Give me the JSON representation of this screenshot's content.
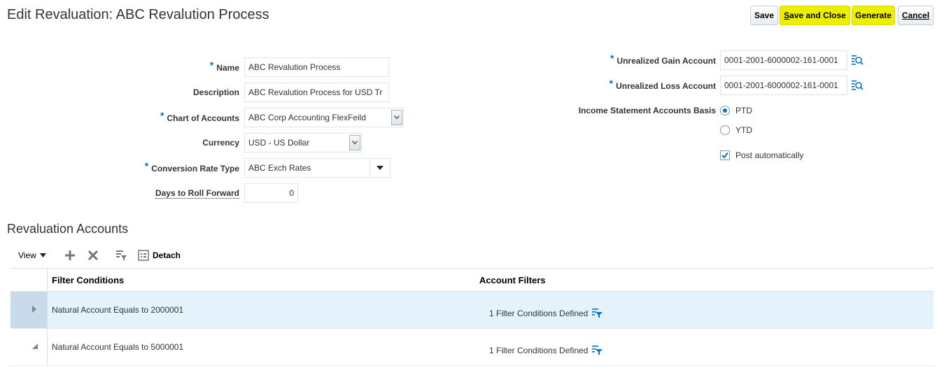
{
  "page": {
    "title": "Edit Revaluation: ABC Revalution Process"
  },
  "toolbar": {
    "save_label": "Save",
    "save_close_prefix": "S",
    "save_close_rest": "ave and Close",
    "generate_label": "Generate",
    "cancel_prefix": "C",
    "cancel_rest": "ancel",
    "highlight_color": "#ecf000"
  },
  "form": {
    "name": {
      "label": "Name",
      "required": true,
      "value": "ABC Revalution Process"
    },
    "description": {
      "label": "Description",
      "value": "ABC Revalution Process for USD Tr"
    },
    "chart_of_accounts": {
      "label": "Chart of Accounts",
      "required": true,
      "value": "ABC Corp Accounting FlexFeild"
    },
    "currency": {
      "label": "Currency",
      "value": "USD - US Dollar"
    },
    "conversion_rate_type": {
      "label": "Conversion Rate Type",
      "required": true,
      "value": "ABC Exch Rates"
    },
    "days_to_roll_forward": {
      "label": "Days to Roll Forward",
      "value": "0"
    },
    "unrealized_gain_account": {
      "label": "Unrealized Gain Account",
      "required": true,
      "value": "0001-2001-6000002-161-0001"
    },
    "unrealized_loss_account": {
      "label": "Unrealized Loss Account",
      "required": true,
      "value": "0001-2001-6000002-161-0001"
    },
    "income_statement_basis": {
      "label": "Income Statement Accounts Basis",
      "options": [
        "PTD",
        "YTD"
      ],
      "selected": "PTD"
    },
    "post_automatically": {
      "label": "Post automatically",
      "checked": true
    },
    "required_marker": "*"
  },
  "section": {
    "title": "Revaluation Accounts"
  },
  "table_toolbar": {
    "view_label": "View",
    "detach_label": "Detach"
  },
  "table": {
    "columns": [
      "Filter Conditions",
      "Account Filters"
    ],
    "rows": [
      {
        "filter_condition": "Natural Account Equals to 2000001",
        "account_filters": "1 Filter Conditions Defined",
        "expanded": false,
        "selected": true
      },
      {
        "filter_condition": "Natural Account Equals to 5000001",
        "account_filters": "1 Filter Conditions Defined",
        "expanded": true,
        "selected": false
      }
    ]
  },
  "colors": {
    "accent": "#0572ce",
    "selected_row": "#e4f2fc"
  }
}
